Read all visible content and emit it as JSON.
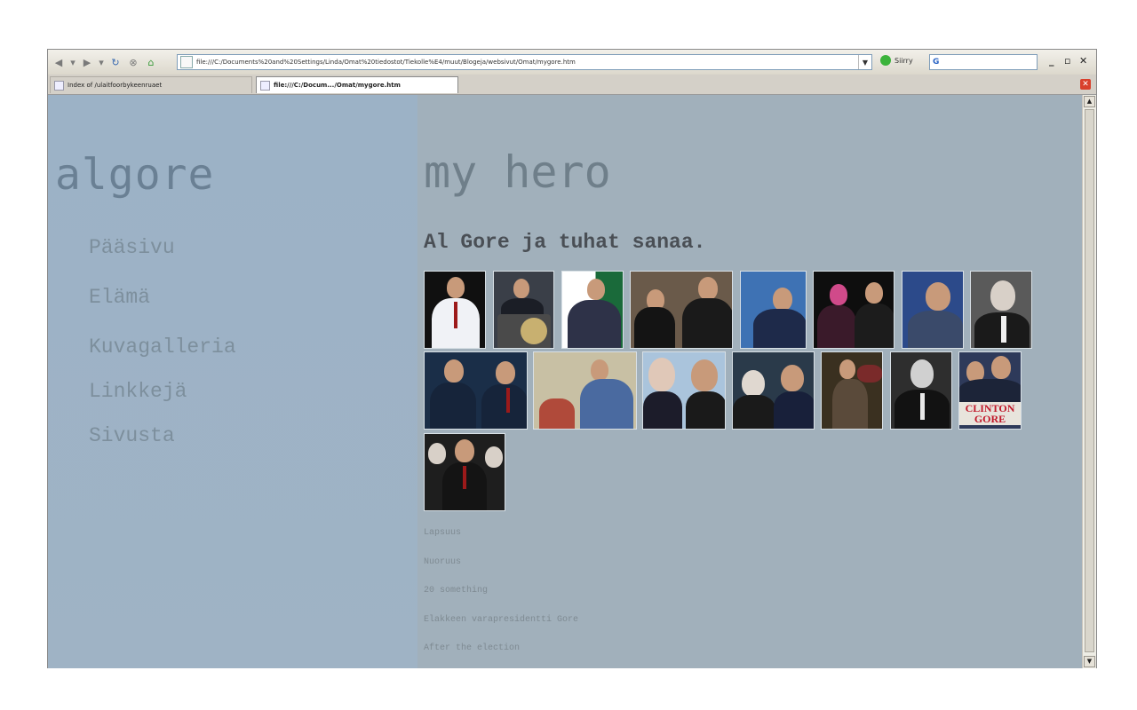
{
  "browser": {
    "url": "file:///C:/Documents%20and%20Settings/Linda/Omat%20tiedostot/Tiekolle%E4/muut/Blogeja/websivut/Omat/mygore.htm",
    "go_label": "Siirry",
    "search_engine_glyph": "G",
    "tabs": [
      {
        "label": "Index of /ulaitfoorbykeenruaet",
        "active": false
      },
      {
        "label": "file:///C:/Docum.../Omat/mygore.htm",
        "active": true
      }
    ]
  },
  "sidebar": {
    "title": "algore",
    "nav": [
      "Pääsivu",
      "Elämä",
      "Kuvagalleria",
      "Linkkejä",
      "Sivusta"
    ]
  },
  "main": {
    "title": "my hero",
    "subtitle": "Al Gore ja tuhat sanaa.",
    "gallery_caption_text": "CLINTON GORE",
    "sublinks": [
      "Lapsuus",
      "Nuoruus",
      "20 something",
      "Elakkeen varapresidentti Gore",
      "After the election"
    ]
  },
  "colors": {
    "page_bg": "#a1b0bb",
    "sidebar_bg": "#9cb2c6",
    "title_color": "#6a8094",
    "subtitle_color": "#4a4f55"
  }
}
